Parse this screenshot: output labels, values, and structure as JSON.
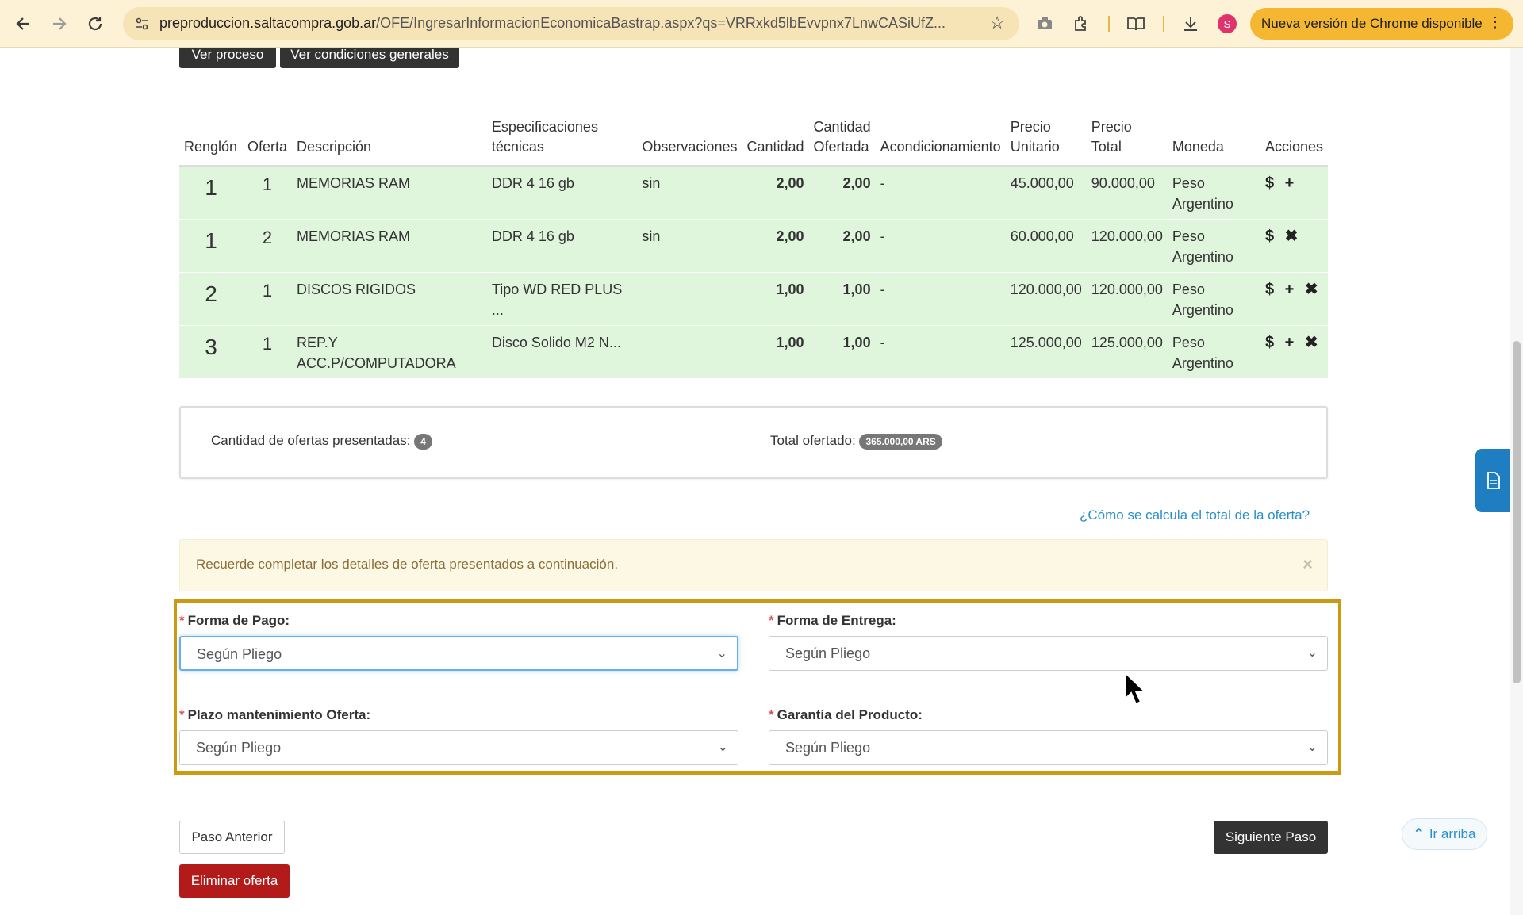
{
  "browser": {
    "url_host": "preproduccion.saltacompra.gob.ar",
    "url_path": "/OFE/IngresarInformacionEconomicaBastrap.aspx?qs=VRRxkd5lbEvvpnx7LnwCASiUfZ...",
    "avatar_letter": "S",
    "update_label": "Nueva versión de Chrome disponible"
  },
  "top_buttons": {
    "ver_proceso": "Ver proceso",
    "ver_condiciones": "Ver condiciones generales"
  },
  "table": {
    "headers": {
      "renglon": "Renglón",
      "oferta": "Oferta",
      "descripcion": "Descripción",
      "especificaciones_1": "Especificaciones",
      "especificaciones_2": "técnicas",
      "observaciones": "Observaciones",
      "cantidad": "Cantidad",
      "cantidad_ofertada_1": "Cantidad",
      "cantidad_ofertada_2": "Ofertada",
      "acondicionamiento": "Acondicionamiento",
      "precio_unitario_1": "Precio",
      "precio_unitario_2": "Unitario",
      "precio_total_1": "Precio",
      "precio_total_2": "Total",
      "moneda": "Moneda",
      "acciones": "Acciones"
    },
    "rows": [
      {
        "renglon": "1",
        "oferta": "1",
        "descripcion": "MEMORIAS RAM",
        "especificaciones": "DDR 4 16 gb",
        "observaciones": "sin",
        "cantidad": "2,00",
        "cantidad_ofertada": "2,00",
        "acondicionamiento": "-",
        "precio_unitario": "45.000,00",
        "precio_total": "90.000,00",
        "moneda": "Peso Argentino",
        "acciones": "$ +"
      },
      {
        "renglon": "1",
        "oferta": "2",
        "descripcion": "MEMORIAS RAM",
        "especificaciones": "DDR 4 16 gb",
        "observaciones": "sin",
        "cantidad": "2,00",
        "cantidad_ofertada": "2,00",
        "acondicionamiento": "-",
        "precio_unitario": "60.000,00",
        "precio_total": "120.000,00",
        "moneda": "Peso Argentino",
        "acciones": "$ ✖"
      },
      {
        "renglon": "2",
        "oferta": "1",
        "descripcion": "DISCOS RIGIDOS",
        "especificaciones": "Tipo WD RED PLUS ...",
        "observaciones": "",
        "cantidad": "1,00",
        "cantidad_ofertada": "1,00",
        "acondicionamiento": "-",
        "precio_unitario": "120.000,00",
        "precio_total": "120.000,00",
        "moneda": "Peso Argentino",
        "acciones": "$ + ✖"
      },
      {
        "renglon": "3",
        "oferta": "1",
        "descripcion": "REP.Y ACC.P/COMPUTADORA",
        "especificaciones": "Disco Solido M2 N...",
        "observaciones": "",
        "cantidad": "1,00",
        "cantidad_ofertada": "1,00",
        "acondicionamiento": "-",
        "precio_unitario": "125.000,00",
        "precio_total": "125.000,00",
        "moneda": "Peso Argentino",
        "acciones": "$ + ✖"
      }
    ]
  },
  "summary": {
    "ofertas_label": "Cantidad de ofertas presentadas:",
    "ofertas_count": "4",
    "total_label": "Total ofertado:",
    "total_value": "365.000,00 ARS"
  },
  "help_link": "¿Cómo se calcula el total de la oferta?",
  "alert": {
    "text": "Recuerde completar los detalles de oferta presentados a continuación.",
    "close": "×"
  },
  "form": {
    "forma_pago": {
      "label": "Forma de Pago:",
      "value": "Según Pliego"
    },
    "forma_entrega": {
      "label": "Forma de Entrega:",
      "value": "Según Pliego"
    },
    "plazo": {
      "label": "Plazo mantenimiento Oferta:",
      "value": "Según Pliego"
    },
    "garantia": {
      "label": "Garantía del Producto:",
      "value": "Según Pliego"
    },
    "required_mark": "*"
  },
  "buttons": {
    "paso_anterior": "Paso Anterior",
    "siguiente_paso": "Siguiente Paso",
    "eliminar_oferta": "Eliminar oferta",
    "ir_arriba": "Ir arriba"
  },
  "colors": {
    "row_green": "#dff5dc",
    "form_border": "#c99a12",
    "danger": "#b31b1b",
    "link": "#2a90c8"
  }
}
